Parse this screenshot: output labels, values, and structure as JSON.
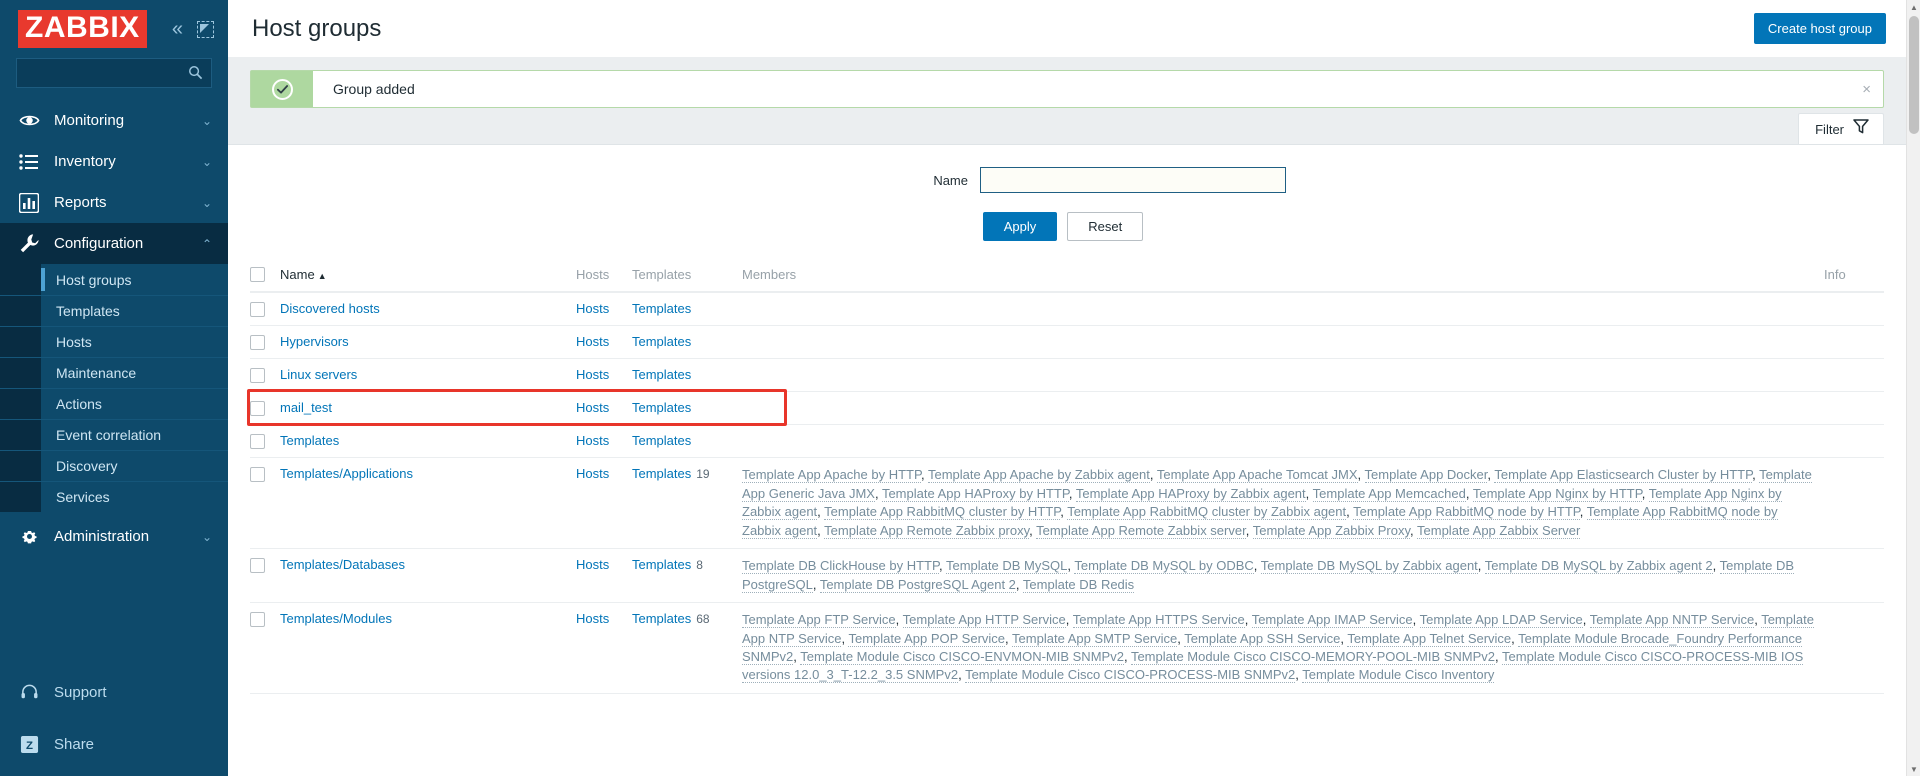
{
  "brand": {
    "logo_text": "ZABBIX"
  },
  "sidebar": {
    "search_placeholder": "",
    "search_value": "",
    "items": [
      {
        "label": "Monitoring",
        "icon": "eye-icon",
        "chevron": "⌄"
      },
      {
        "label": "Inventory",
        "icon": "list-icon",
        "chevron": "⌄"
      },
      {
        "label": "Reports",
        "icon": "bar-chart-icon",
        "chevron": "⌄"
      },
      {
        "label": "Configuration",
        "icon": "wrench-icon",
        "chevron": "⌃"
      }
    ],
    "configuration_subitems": [
      {
        "label": "Host groups",
        "selected": true
      },
      {
        "label": "Templates",
        "selected": false
      },
      {
        "label": "Hosts",
        "selected": false
      },
      {
        "label": "Maintenance",
        "selected": false
      },
      {
        "label": "Actions",
        "selected": false
      },
      {
        "label": "Event correlation",
        "selected": false
      },
      {
        "label": "Discovery",
        "selected": false
      },
      {
        "label": "Services",
        "selected": false
      }
    ],
    "administration": {
      "label": "Administration",
      "icon": "gear-icon",
      "chevron": "⌄"
    },
    "bottom_items": [
      {
        "label": "Support",
        "icon": "headset-icon"
      },
      {
        "label": "Share",
        "icon": "zabbix-share-icon"
      }
    ],
    "collapse_icon": "«",
    "fullscreen_icon": "collapse-window-icon",
    "search_icon": "search-icon"
  },
  "header": {
    "title": "Host groups",
    "create_button": "Create host group"
  },
  "message": {
    "text": "Group added",
    "icon": "check-circle-icon",
    "close": "×"
  },
  "filter": {
    "tab_label": "Filter",
    "tab_icon": "funnel-icon",
    "name_label": "Name",
    "name_value": "",
    "name_placeholder": "",
    "apply_label": "Apply",
    "reset_label": "Reset"
  },
  "table": {
    "headers": {
      "name": "Name",
      "sort_arrow": "▲",
      "hosts": "Hosts",
      "templates": "Templates",
      "members": "Members",
      "info": "Info"
    },
    "rows": [
      {
        "name": "Discovered hosts",
        "hosts": "Hosts",
        "templates": "Templates",
        "template_count": "",
        "members": [],
        "highlighted": false
      },
      {
        "name": "Hypervisors",
        "hosts": "Hosts",
        "templates": "Templates",
        "template_count": "",
        "members": [],
        "highlighted": false
      },
      {
        "name": "Linux servers",
        "hosts": "Hosts",
        "templates": "Templates",
        "template_count": "",
        "members": [],
        "highlighted": false
      },
      {
        "name": "mail_test",
        "hosts": "Hosts",
        "templates": "Templates",
        "template_count": "",
        "members": [],
        "highlighted": true
      },
      {
        "name": "Templates",
        "hosts": "Hosts",
        "templates": "Templates",
        "template_count": "",
        "members": [],
        "highlighted": false
      },
      {
        "name": "Templates/Applications",
        "hosts": "Hosts",
        "templates": "Templates",
        "template_count": "19",
        "members": [
          "Template App Apache by HTTP",
          "Template App Apache by Zabbix agent",
          "Template App Apache Tomcat JMX",
          "Template App Docker",
          "Template App Elasticsearch Cluster by HTTP",
          "Template App Generic Java JMX",
          "Template App HAProxy by HTTP",
          "Template App HAProxy by Zabbix agent",
          "Template App Memcached",
          "Template App Nginx by HTTP",
          "Template App Nginx by Zabbix agent",
          "Template App RabbitMQ cluster by HTTP",
          "Template App RabbitMQ cluster by Zabbix agent",
          "Template App RabbitMQ node by HTTP",
          "Template App RabbitMQ node by Zabbix agent",
          "Template App Remote Zabbix proxy",
          "Template App Remote Zabbix server",
          "Template App Zabbix Proxy",
          "Template App Zabbix Server"
        ],
        "highlighted": false
      },
      {
        "name": "Templates/Databases",
        "hosts": "Hosts",
        "templates": "Templates",
        "template_count": "8",
        "members": [
          "Template DB ClickHouse by HTTP",
          "Template DB MySQL",
          "Template DB MySQL by ODBC",
          "Template DB MySQL by Zabbix agent",
          "Template DB MySQL by Zabbix agent 2",
          "Template DB PostgreSQL",
          "Template DB PostgreSQL Agent 2",
          "Template DB Redis"
        ],
        "highlighted": false
      },
      {
        "name": "Templates/Modules",
        "hosts": "Hosts",
        "templates": "Templates",
        "template_count": "68",
        "members": [
          "Template App FTP Service",
          "Template App HTTP Service",
          "Template App HTTPS Service",
          "Template App IMAP Service",
          "Template App LDAP Service",
          "Template App NNTP Service",
          "Template App NTP Service",
          "Template App POP Service",
          "Template App SMTP Service",
          "Template App SSH Service",
          "Template App Telnet Service",
          "Template Module Brocade_Foundry Performance SNMPv2",
          "Template Module Cisco CISCO-ENVMON-MIB SNMPv2",
          "Template Module Cisco CISCO-MEMORY-POOL-MIB SNMPv2",
          "Template Module Cisco CISCO-PROCESS-MIB IOS versions 12.0_3_T-12.2_3.5 SNMPv2",
          "Template Module Cisco CISCO-PROCESS-MIB SNMPv2",
          "Template Module Cisco Inventory"
        ],
        "highlighted": false
      }
    ]
  },
  "colors": {
    "sidebar_bg": "#0e4a6b",
    "sidebar_active": "#082c42",
    "brand_red": "#e8392e",
    "accent_blue": "#0275b8",
    "success_green": "#aed8a0",
    "highlight_red": "#e8352a",
    "link_blue": "#0275b8",
    "member_gray": "#768d9c"
  }
}
